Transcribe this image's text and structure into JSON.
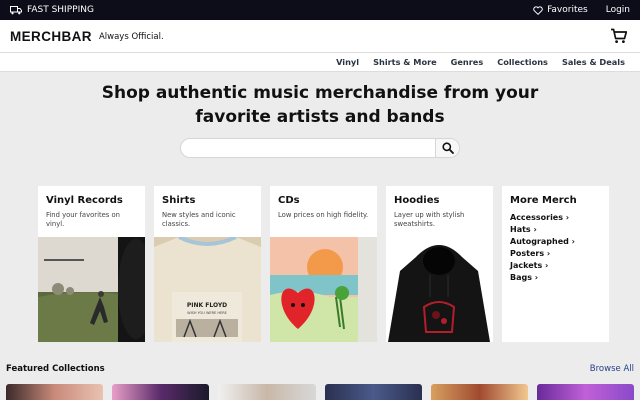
{
  "topbar": {
    "shipping": "FAST SHIPPING",
    "favorites": "Favorites",
    "login": "Login"
  },
  "header": {
    "logo": "MERCHBAR",
    "tagline": "Always Official."
  },
  "nav": [
    "Vinyl",
    "Shirts & More",
    "Genres",
    "Collections",
    "Sales & Deals"
  ],
  "hero": {
    "line1": "Shop authentic music merchandise from your",
    "line2": "favorite artists and bands"
  },
  "search": {
    "value": "",
    "placeholder": ""
  },
  "categories": [
    {
      "title": "Vinyl Records",
      "sub": "Find your favorites on vinyl."
    },
    {
      "title": "Shirts",
      "sub": "New styles and iconic classics."
    },
    {
      "title": "CDs",
      "sub": "Low prices on high fidelity."
    },
    {
      "title": "Hoodies",
      "sub": "Layer up with stylish sweatshirts."
    }
  ],
  "more": {
    "title": "More Merch",
    "links": [
      "Accessories ›",
      "Hats ›",
      "Autographed ›",
      "Posters ›",
      "Jackets ›",
      "Bags ›"
    ]
  },
  "featured": {
    "title": "Featured Collections",
    "browse": "Browse All"
  },
  "colors": {
    "topbar": "#0d0d1a",
    "page_bg": "#ececec",
    "nav_text": "#2a3440",
    "link": "#24428a"
  }
}
